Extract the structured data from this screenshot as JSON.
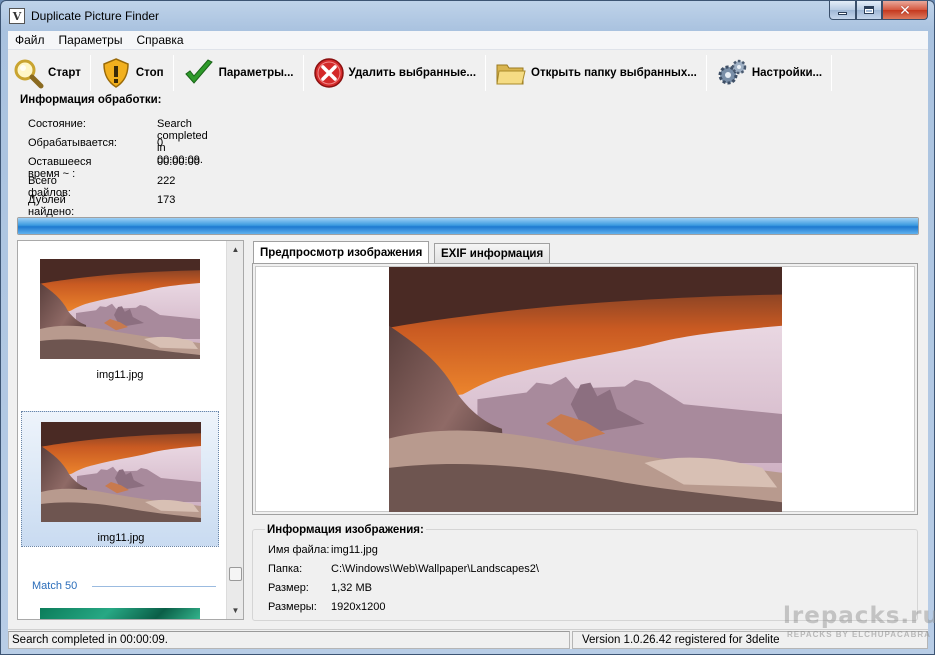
{
  "window": {
    "title": "Duplicate Picture Finder"
  },
  "menu": [
    "Файл",
    "Параметры",
    "Справка"
  ],
  "toolbar": {
    "start_label": "Старт",
    "stop_label": "Стоп",
    "params_label": "Параметры...",
    "delete_label": "Удалить выбранные...",
    "open_folder_label": "Открыть папку выбранных...",
    "settings_label": "Настройки..."
  },
  "processing": {
    "title": "Информация обработки:",
    "rows": [
      {
        "label": "Состояние:",
        "value": "Search completed in 00:00:09."
      },
      {
        "label": "Обрабатывается:",
        "value": "0"
      },
      {
        "label": "Оставшееся время ~ :",
        "value": "00:00:00"
      },
      {
        "label": "Всего файлов:",
        "value": "222"
      },
      {
        "label": "Дублей найдено:",
        "value": "173"
      }
    ],
    "progress_fraction": 1.0
  },
  "thumbnails": {
    "items": [
      {
        "name": "img11.jpg"
      },
      {
        "name": "img11.jpg"
      }
    ],
    "match_label": "Match 50"
  },
  "tabs": {
    "preview": "Предпросмотр изображения",
    "exif": "EXIF информация"
  },
  "image_info": {
    "title": "Информация изображения:",
    "rows": [
      {
        "label": "Имя файла:",
        "value": "img11.jpg"
      },
      {
        "label": "Папка:",
        "value": "C:\\Windows\\Web\\Wallpaper\\Landscapes2\\"
      },
      {
        "label": "Размер:",
        "value": "1,32 MB"
      },
      {
        "label": "Размеры:",
        "value": "1920x1200"
      }
    ]
  },
  "status": {
    "left": "Search completed in 00:00:09.",
    "right": "Version 1.0.26.42 registered for 3delite"
  },
  "watermark": {
    "main": "lrepacks.ru",
    "sub": "REPACKS BY ELCHUPACABRA"
  }
}
